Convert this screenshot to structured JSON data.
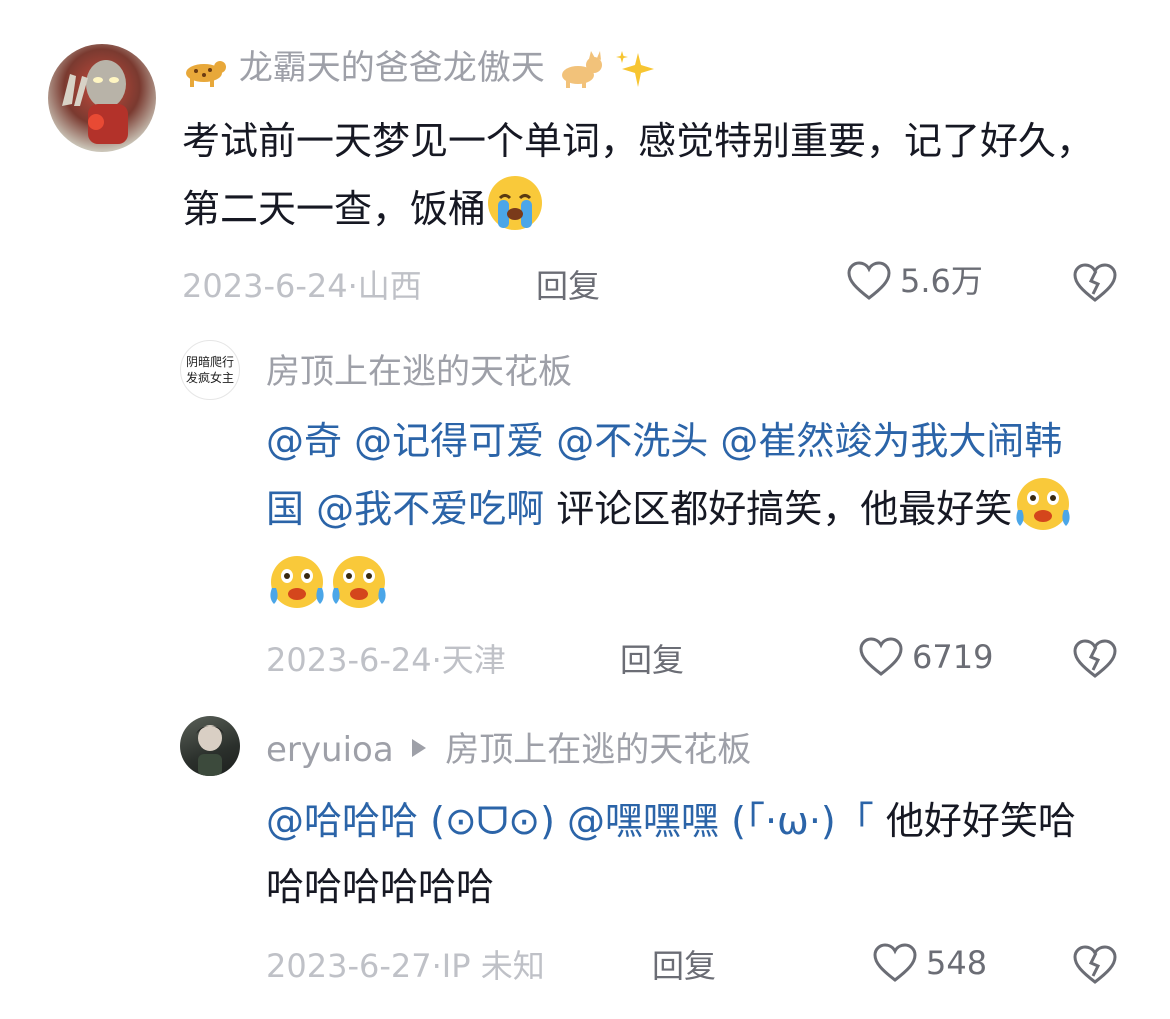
{
  "comments": [
    {
      "username_prefix_icon": "leopard-emoji",
      "username": "龙霸天的爸爸龙傲天",
      "username_suffix_icons": [
        "cat-emoji",
        "sparkles-emoji"
      ],
      "avatar": "avatar-red-hero",
      "text": "考试前一天梦见一个单词，感觉特别重要，记了好久，第二天一查，饭桶",
      "text_suffix_icon": "loudly-crying-face-emoji",
      "date": "2023-6-24",
      "location": "山西",
      "reply_label": "回复",
      "likes": "5.6万"
    },
    {
      "username": "房顶上在逃的天花板",
      "avatar_text": "阴暗爬行\n发疯女主",
      "mentions": [
        "@奇",
        "@记得可爱",
        "@不洗头",
        "@崔然竣为我大闹韩国",
        "@我不爱吃啊"
      ],
      "text": "评论区都好搞笑，他最好笑",
      "text_suffix_icons": [
        "crying-laughing-face-emoji",
        "crying-laughing-face-emoji",
        "crying-laughing-face-emoji"
      ],
      "date": "2023-6-24",
      "location": "天津",
      "reply_label": "回复",
      "likes": "6719"
    },
    {
      "username": "eryuioa",
      "reply_to": "房顶上在逃的天花板",
      "avatar": "avatar-dark-portrait",
      "mentions": [
        "@哈哈哈 (⊙ᗜ⊙)",
        "@嘿嘿嘿 (「·ω·)「"
      ],
      "text": "他好好笑哈哈哈哈哈哈哈",
      "date": "2023-6-27",
      "location": "IP 未知",
      "reply_label": "回复",
      "likes": "548"
    }
  ],
  "colors": {
    "mention": "#2b64a8",
    "username": "#9ea0a8",
    "meta": "#bfc1c7",
    "text": "#161823"
  }
}
